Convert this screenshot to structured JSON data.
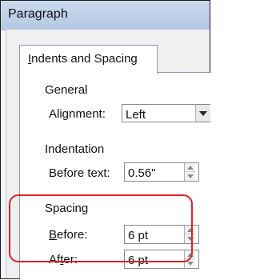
{
  "dialog": {
    "title": "Paragraph"
  },
  "tabs": [
    {
      "label_pre": "",
      "label_ul": "I",
      "label_post": "ndents and Spacing"
    }
  ],
  "general": {
    "heading": "General",
    "alignment_label_pre": "Ali",
    "alignment_label_ul": "g",
    "alignment_label_post": "nment:",
    "alignment_value": "Left"
  },
  "indentation": {
    "heading": "Indentation",
    "before_text_label_pre": "Before text:",
    "before_text_value": "0.56\""
  },
  "spacing": {
    "heading": "Spacing",
    "before_label_pre": "",
    "before_label_ul": "B",
    "before_label_post": "efore:",
    "before_value": "6 pt",
    "after_label_pre": "Af",
    "after_label_ul": "t",
    "after_label_post": "er:",
    "after_value": "6 pt"
  },
  "annotation": {
    "color": "#e0222a",
    "shape": "rounded-rectangle"
  }
}
